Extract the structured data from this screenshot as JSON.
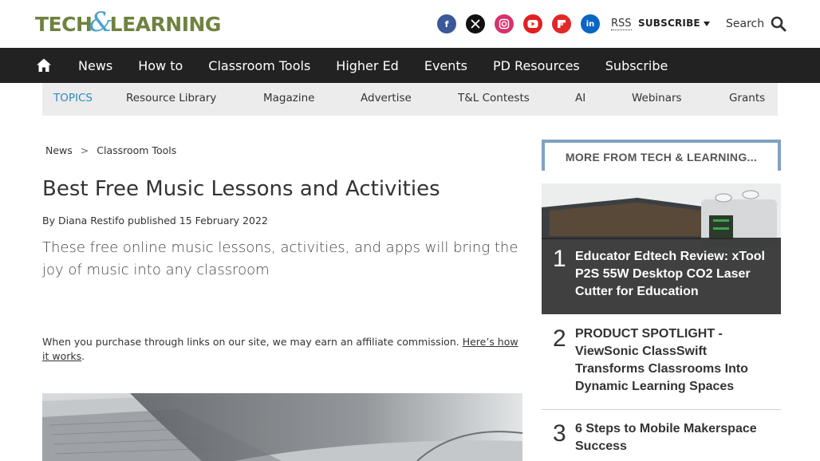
{
  "brand": {
    "logo_left": "TECH",
    "logo_amp": "&",
    "logo_right": "LEARNING"
  },
  "header": {
    "social": [
      {
        "icon": "facebook-icon",
        "glyph": "f",
        "color": "#3b5998"
      },
      {
        "icon": "x-icon",
        "glyph": "𝕏",
        "color": "#111111"
      },
      {
        "icon": "instagram-icon",
        "glyph": "◎",
        "color": "#d6336c"
      },
      {
        "icon": "youtube-icon",
        "glyph": "▶",
        "color": "#e02020"
      },
      {
        "icon": "flipboard-icon",
        "glyph": "f",
        "color": "#e12828"
      },
      {
        "icon": "linkedin-icon",
        "glyph": "in",
        "color": "#0a66c2"
      }
    ],
    "rss_label": "RSS",
    "subscribe_label": "SUBSCRIBE",
    "search_label": "Search"
  },
  "nav": {
    "items": [
      "News",
      "How to",
      "Classroom Tools",
      "Higher Ed",
      "Events",
      "PD Resources",
      "Subscribe"
    ]
  },
  "topics": {
    "label": "TOPICS",
    "items": [
      "Resource Library",
      "Magazine",
      "Advertise",
      "T&L Contests",
      "AI",
      "Webinars",
      "Grants"
    ]
  },
  "article": {
    "breadcrumb": [
      "News",
      "Classroom Tools"
    ],
    "breadcrumb_sep": ">",
    "title": "Best Free Music Lessons and Activities",
    "byline_prefix": "By",
    "author": "Diana Restifo",
    "published_text": "published 15 February 2022",
    "standfirst": "These free online music lessons, activities, and apps will bring the joy of music into any classroom",
    "affiliate_text": "When you purchase through links on our site, we may earn an affiliate commission.",
    "affiliate_link": "Here’s how it works",
    "affiliate_end": "."
  },
  "sidebar": {
    "header": "MORE FROM TECH & LEARNING...",
    "items": [
      {
        "num": "1",
        "title": "Educator Edtech Review: xTool P2S 55W Desktop CO2 Laser Cutter for Education"
      },
      {
        "num": "2",
        "title": "PRODUCT SPOTLIGHT - ViewSonic ClassSwift Transforms Classrooms Into Dynamic Learning Spaces"
      },
      {
        "num": "3",
        "title": "6 Steps to Mobile Makerspace Success"
      }
    ]
  }
}
